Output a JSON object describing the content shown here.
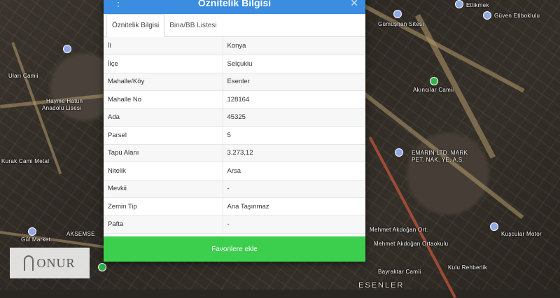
{
  "modal": {
    "title": "Öznitelik Bilgisi",
    "kebab_icon": "⋮",
    "close_icon": "✕",
    "tabs": [
      {
        "label": "Öznitelik Bilgisi",
        "active": true
      },
      {
        "label": "Bina/BB Listesi",
        "active": false
      }
    ],
    "rows": [
      {
        "key": "İl",
        "value": "Konya"
      },
      {
        "key": "İlçe",
        "value": "Selçuklu"
      },
      {
        "key": "Mahalle/Köy",
        "value": "Esenler"
      },
      {
        "key": "Mahalle No",
        "value": "128164"
      },
      {
        "key": "Ada",
        "value": "45325"
      },
      {
        "key": "Parsel",
        "value": "5"
      },
      {
        "key": "Tapu Alanı",
        "value": "3.273,12"
      },
      {
        "key": "Nitelik",
        "value": "Arsa"
      },
      {
        "key": "Mevkii",
        "value": "-"
      },
      {
        "key": "Zemin Tip",
        "value": "Ana Taşınmaz"
      },
      {
        "key": "Pafta",
        "value": "-"
      }
    ],
    "favorite_button": "Favorilere ekle"
  },
  "map_labels": {
    "l1": "Etlikmek",
    "l2": "Güven Etiboklulu",
    "l3": "Gümüşhan Sitesi",
    "l4": "Uları Camii",
    "l5": "Hayme Hatun",
    "l6": "Anadolu Lisesi",
    "l7": "Akıncılar Camii",
    "l8": "Kurak Cami Metal",
    "l9": "Gül Market",
    "l10": "AKSEMSE",
    "l11": "EMARIN LTD. MARK",
    "l12": "PET. NAK. YE. A.S.",
    "l13": "Mehmet Akdoğan Ort.",
    "l14": "Kuşcular Motor",
    "l15": "Bayraktar Camii",
    "l16": "Kulu Rehberlik",
    "l17": "ESENLER",
    "l18": "Mehmet Akdoğan Ortaokulu"
  },
  "logo": {
    "text": "ONUR"
  },
  "colors": {
    "header": "#3a8de0",
    "button": "#3ccf4e"
  }
}
